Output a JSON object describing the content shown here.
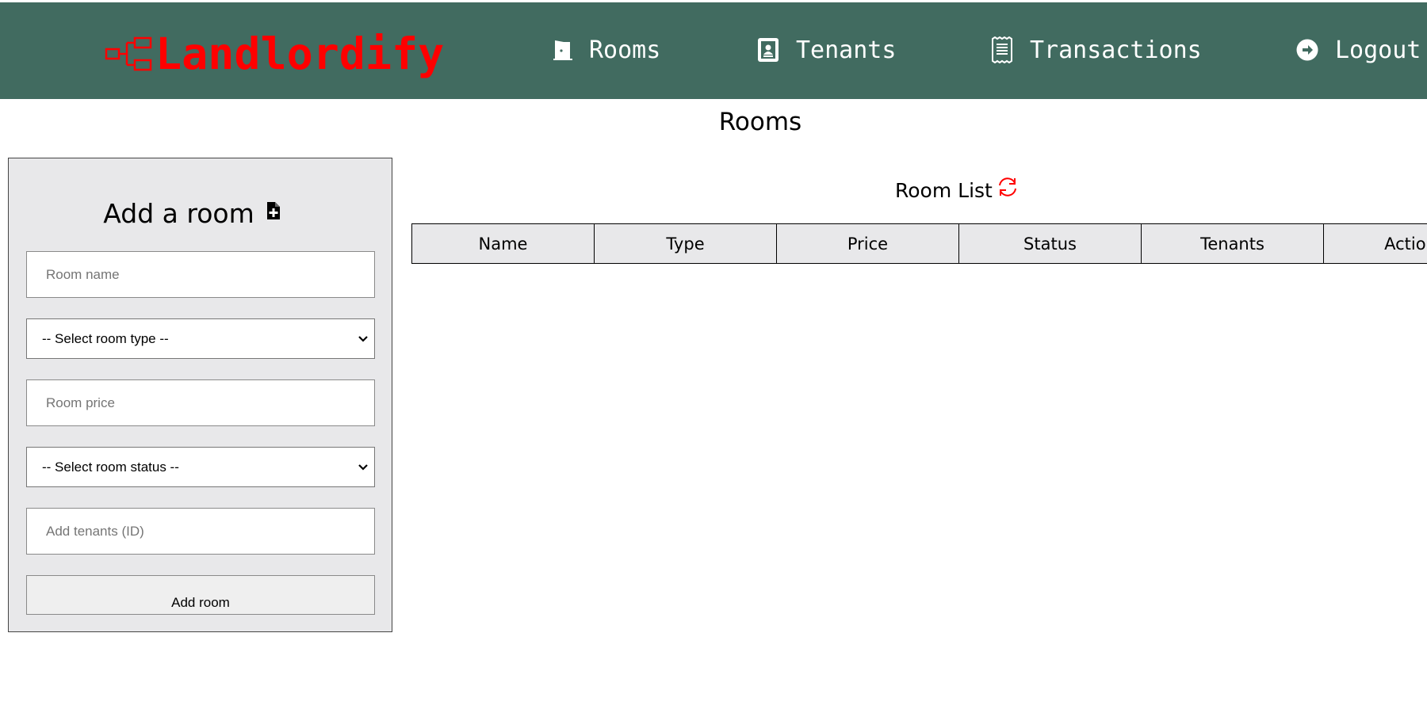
{
  "header": {
    "logo_text": "Landlordify",
    "logo_color": "#ff0000",
    "background_color": "#416b60",
    "nav": [
      {
        "label": "Rooms",
        "icon": "door-icon"
      },
      {
        "label": "Tenants",
        "icon": "id-card-icon"
      },
      {
        "label": "Transactions",
        "icon": "receipt-icon"
      },
      {
        "label": "Logout",
        "icon": "logout-icon"
      }
    ]
  },
  "page": {
    "title": "Rooms"
  },
  "add_room": {
    "title": "Add a room",
    "title_icon": "file-plus-icon",
    "room_name_placeholder": "Room name",
    "room_type_selected": "-- Select room type --",
    "room_price_placeholder": "Room price",
    "room_status_selected": "-- Select room status --",
    "tenants_placeholder": "Add tenants (ID)",
    "submit_label": "Add room"
  },
  "room_list": {
    "title": "Room List",
    "refresh_icon": "refresh-icon",
    "refresh_color": "#ff0000",
    "columns": [
      "Name",
      "Type",
      "Price",
      "Status",
      "Tenants",
      "Actions"
    ],
    "rows": []
  }
}
